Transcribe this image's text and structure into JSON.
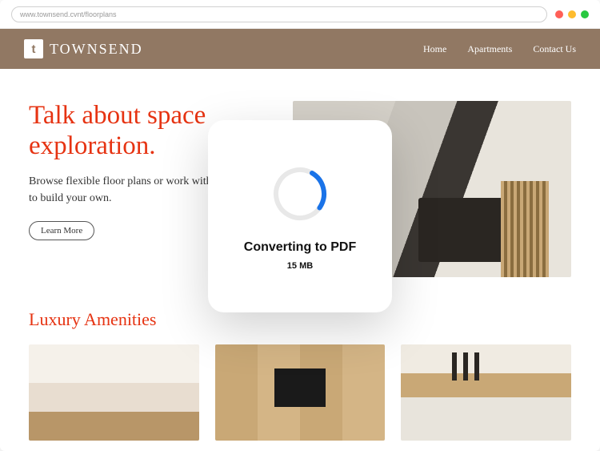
{
  "browser": {
    "url": "www.townsend.cvnt/floorplans"
  },
  "brand": {
    "logo_letter": "t",
    "name": "TOWNSEND"
  },
  "nav": {
    "home": "Home",
    "apartments": "Apartments",
    "contact": "Contact Us"
  },
  "hero": {
    "headline_line1": "Talk about space",
    "headline_line2": "exploration.",
    "subhead": "Browse flexible floor plans or work with a designer to build your own.",
    "cta": "Learn More"
  },
  "amenities": {
    "title": "Luxury Amenities"
  },
  "modal": {
    "title": "Converting to PDF",
    "size": "15 MB"
  }
}
